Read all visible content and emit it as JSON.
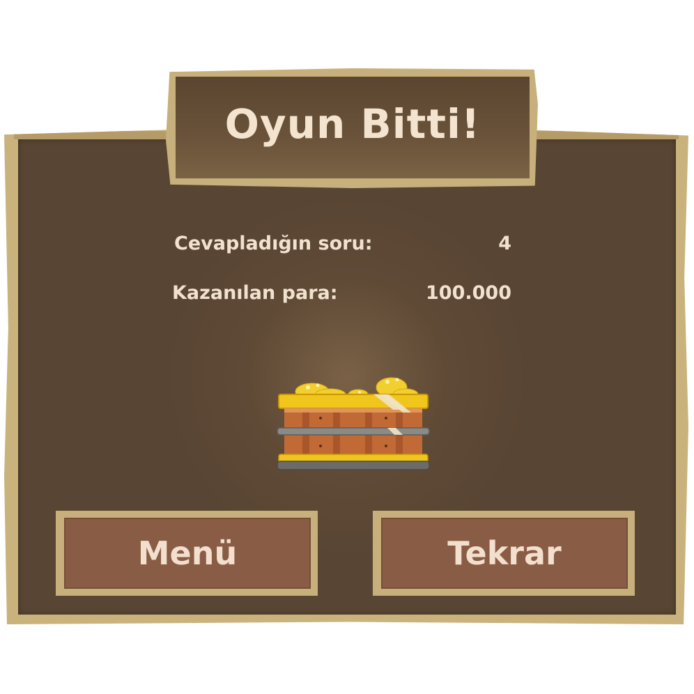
{
  "dialog": {
    "title": "Oyun Bitti!"
  },
  "stats": [
    {
      "label": "Cevapladığın soru:",
      "value": "4"
    },
    {
      "label": "Kazanılan para:",
      "value": "100.000"
    }
  ],
  "reward_image": "treasure-chest-with-gold-icon",
  "buttons": {
    "menu_label": "Menü",
    "retry_label": "Tekrar"
  },
  "colors": {
    "board_wood": "#5f4a36",
    "frame": "#c9b27c",
    "button_fill": "#895c45",
    "text": "#f1e2cf"
  }
}
